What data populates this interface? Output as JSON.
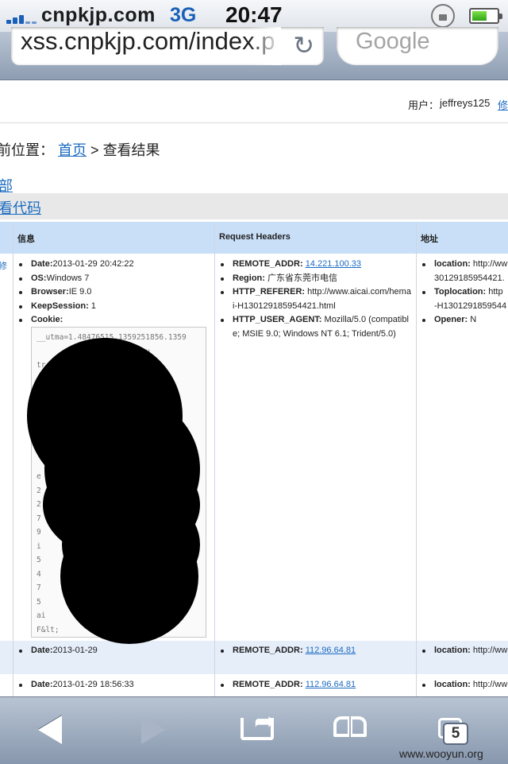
{
  "status_bar": {
    "carrier": "cnpkjp.com",
    "network": "3G",
    "time": "20:47",
    "icons": [
      "signal-icon",
      "rotation-lock-icon",
      "battery-icon"
    ]
  },
  "browser": {
    "url": "xss.cnpkjp.com/index.ph",
    "search_placeholder": "Google"
  },
  "page": {
    "user_label": "用户：",
    "user_name": "jeffreys125",
    "user_edit": "修",
    "breadcrumb_prefix": "前位置：",
    "breadcrumb_home": "首页",
    "breadcrumb_sep": ">",
    "breadcrumb_current": "查看结果",
    "link_all": "部",
    "link_view_code": "看代码",
    "table": {
      "headers": [
        "信息",
        "Request Headers",
        "地址"
      ],
      "row1": {
        "edge_link": "修",
        "info": [
          {
            "key": "Date:",
            "value": "2013-01-29 20:42:22"
          },
          {
            "key": "OS:",
            "value": "Windows 7"
          },
          {
            "key": "Browser:",
            "value": "IE 9.0"
          },
          {
            "key": "KeepSession:",
            "value": " 1"
          },
          {
            "key": "Cookie:",
            "value": ""
          }
        ],
        "cookie_text": "__utma=1.48476515.1359251856.1359\n                 .11; __u\ntr                cmcsr=(\n                    tmcm\n                    24B\n                    =2\n                    i\n\n\n\ne\n2\n2\n7\n9\ni\n5\n4\n7\n5\nai\nF&lt;                    me=0",
        "headers": [
          {
            "key": "REMOTE_ADDR:",
            "value": "14.221.100.33"
          },
          {
            "key": "Region:",
            "value": " 广东省东莞市电信"
          },
          {
            "key": "HTTP_REFERER:",
            "value": " http://www.aicai.com/hemai-H130129185954421.html"
          },
          {
            "key": "HTTP_USER_AGENT:",
            "value": " Mozilla/5.0 (compatible; MSIE 9.0; Windows NT 6.1; Trident/5.0)"
          }
        ],
        "location": [
          {
            "key": "location:",
            "value": " http://ww 30129185954421."
          },
          {
            "key": "Toplocation:",
            "value": " http -H1301291859544"
          },
          {
            "key": "Opener:",
            "value": " N"
          }
        ]
      },
      "row2": {
        "date_key": "Date:",
        "date_value": "2013-01-29",
        "remote_key": "REMOTE_ADDR:",
        "remote_value": "112.96.64.81",
        "location_key": "location:",
        "location_value": " http://ww"
      },
      "row3": {
        "date_key": "Date:",
        "date_value": "2013-01-29 18:56:33",
        "remote_key": "REMOTE_ADDR:",
        "remote_value": "112.96.64.81",
        "location_key": "location:",
        "location_value": " http://ww"
      }
    }
  },
  "toolbar": {
    "tab_count": "5",
    "icons": [
      "back-icon",
      "forward-icon",
      "share-icon",
      "bookmarks-icon",
      "tabs-icon"
    ]
  },
  "watermark": "www.wooyun.org"
}
